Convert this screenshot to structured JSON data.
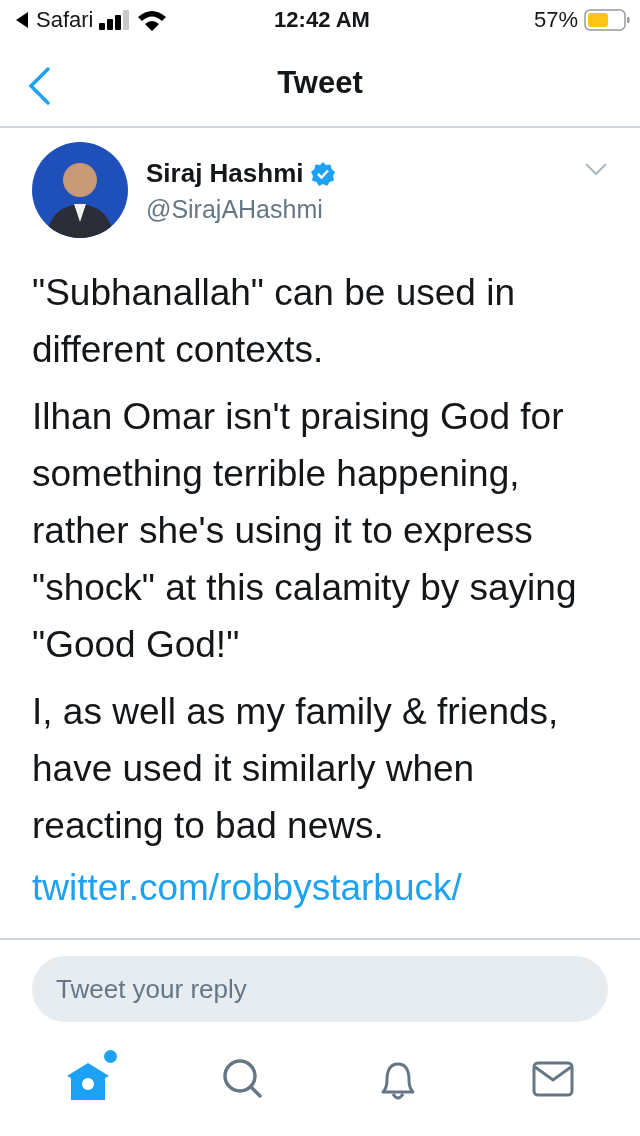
{
  "status_bar": {
    "back_app": "Safari",
    "time": "12:42 AM",
    "battery": "57%"
  },
  "nav": {
    "title": "Tweet"
  },
  "tweet": {
    "name": "Siraj Hashmi",
    "verified": true,
    "handle": "@SirajAHashmi",
    "paragraphs": [
      "\"Subhanallah\" can be used in different contexts.",
      "Ilhan Omar isn't praising God for something terrible happening, rather she's using it to express \"shock\" at this calamity by saying \"Good God!\"",
      "I, as well as my family & friends, have used it similarly when reacting to bad news."
    ],
    "link": "twitter.com/robbystarbuck/"
  },
  "reply": {
    "placeholder": "Tweet your reply"
  },
  "tabs": [
    {
      "kind": "home",
      "selected": true,
      "new_content": true
    },
    {
      "kind": "search",
      "selected": false,
      "new_content": false
    },
    {
      "kind": "notifications",
      "selected": false,
      "new_content": false
    },
    {
      "kind": "messages",
      "selected": false,
      "new_content": false
    }
  ]
}
